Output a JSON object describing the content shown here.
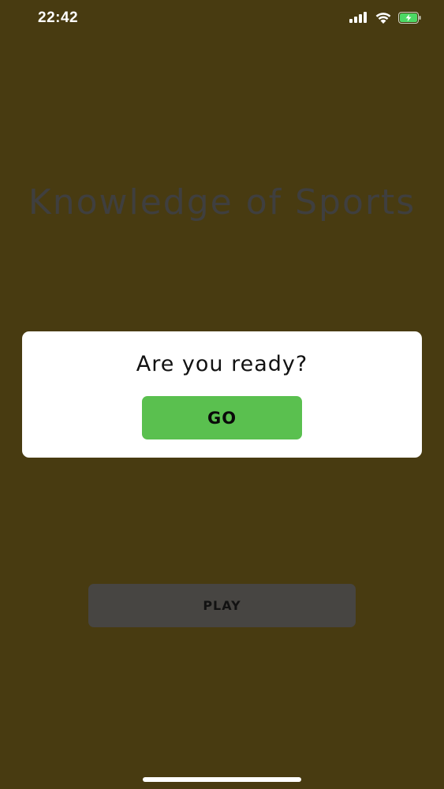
{
  "status_bar": {
    "time": "22:42",
    "icons": [
      "signal-icon",
      "wifi-icon",
      "battery-charging-icon"
    ]
  },
  "app": {
    "title": "Knowledge of Sports",
    "play_label": "PLAY"
  },
  "dialog": {
    "message": "Are you ready?",
    "go_label": "GO"
  },
  "colors": {
    "background_overlay": "#483b11",
    "dialog_background": "#ffffff",
    "go_button": "#5ac04f",
    "play_button": "#474542",
    "battery": "#4cd964"
  }
}
